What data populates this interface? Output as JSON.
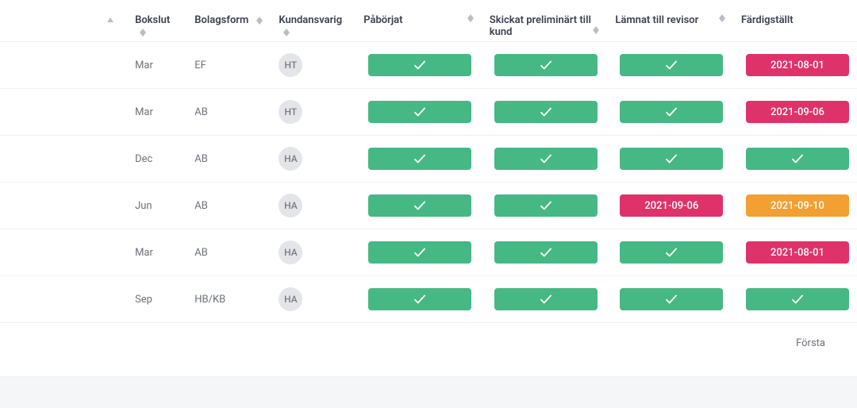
{
  "columns": {
    "bokslut": "Bokslut",
    "bolagsform": "Bolagsform",
    "kundansvarig": "Kundansvarig",
    "paborjat": "Påbörjat",
    "skickat": "Skickat preliminärt till kund",
    "lamnat": "Lämnat till revisor",
    "fardig": "Färdigställt"
  },
  "rows": [
    {
      "bokslut": "Mar",
      "bolagsform": "EF",
      "kundansvarig": "HT",
      "paborjat": {
        "state": "done"
      },
      "skickat": {
        "state": "done"
      },
      "lamnat": {
        "state": "done"
      },
      "fardig": {
        "state": "date-pink",
        "text": "2021-08-01"
      }
    },
    {
      "bokslut": "Mar",
      "bolagsform": "AB",
      "kundansvarig": "HT",
      "paborjat": {
        "state": "done"
      },
      "skickat": {
        "state": "done"
      },
      "lamnat": {
        "state": "done"
      },
      "fardig": {
        "state": "date-pink",
        "text": "2021-09-06"
      }
    },
    {
      "bokslut": "Dec",
      "bolagsform": "AB",
      "kundansvarig": "HA",
      "paborjat": {
        "state": "done"
      },
      "skickat": {
        "state": "done"
      },
      "lamnat": {
        "state": "done"
      },
      "fardig": {
        "state": "done"
      }
    },
    {
      "bokslut": "Jun",
      "bolagsform": "AB",
      "kundansvarig": "HA",
      "paborjat": {
        "state": "done"
      },
      "skickat": {
        "state": "done"
      },
      "lamnat": {
        "state": "date-pink",
        "text": "2021-09-06"
      },
      "fardig": {
        "state": "date-orange",
        "text": "2021-09-10"
      }
    },
    {
      "bokslut": "Mar",
      "bolagsform": "AB",
      "kundansvarig": "HA",
      "paborjat": {
        "state": "done"
      },
      "skickat": {
        "state": "done"
      },
      "lamnat": {
        "state": "done"
      },
      "fardig": {
        "state": "date-pink",
        "text": "2021-08-01"
      }
    },
    {
      "bokslut": "Sep",
      "bolagsform": "HB/KB",
      "kundansvarig": "HA",
      "paborjat": {
        "state": "done"
      },
      "skickat": {
        "state": "done"
      },
      "lamnat": {
        "state": "done"
      },
      "fardig": {
        "state": "done"
      }
    }
  ],
  "pager": {
    "first": "Första"
  },
  "colors": {
    "green": "#45b884",
    "pink": "#e0326a",
    "orange": "#f2a031"
  }
}
